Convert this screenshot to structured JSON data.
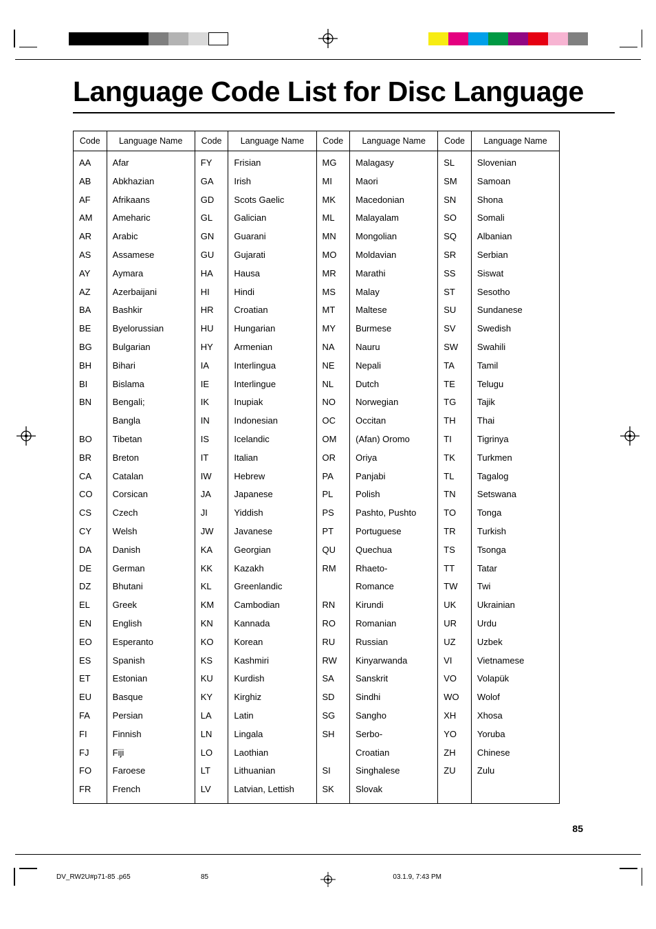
{
  "title": "Language Code List for Disc Language",
  "page_number": "85",
  "footer": {
    "file": "DV_RW2U#p71-85 .p65",
    "page": "85",
    "date": "03.1.9, 7:43 PM"
  },
  "headers": {
    "code": "Code",
    "name": "Language Name"
  },
  "swatches_left": [
    "#000",
    "#000",
    "#000",
    "#000",
    "#7f7f7f",
    "#b3b3b3",
    "#d9d9d9",
    "#fff"
  ],
  "swatches_right": [
    "#f7ec13",
    "#e4007f",
    "#00a0e9",
    "#009944",
    "#920783",
    "#e60012",
    "#f7b4d2",
    "#808080"
  ],
  "columns": [
    {
      "codes": [
        "AA",
        "AB",
        "AF",
        "AM",
        "AR",
        "AS",
        "AY",
        "AZ",
        "BA",
        "BE",
        "BG",
        "BH",
        "BI",
        "BN",
        "",
        "BO",
        "BR",
        "CA",
        "CO",
        "CS",
        "CY",
        "DA",
        "DE",
        "DZ",
        "EL",
        "EN",
        "EO",
        "ES",
        "ET",
        "EU",
        "FA",
        "FI",
        "FJ",
        "FO",
        "FR"
      ],
      "names": [
        "Afar",
        "Abkhazian",
        "Afrikaans",
        "Ameharic",
        "Arabic",
        "Assamese",
        "Aymara",
        "Azerbaijani",
        "Bashkir",
        "Byelorussian",
        "Bulgarian",
        "Bihari",
        "Bislama",
        "Bengali;",
        "Bangla",
        "Tibetan",
        "Breton",
        "Catalan",
        "Corsican",
        "Czech",
        "Welsh",
        "Danish",
        "German",
        "Bhutani",
        "Greek",
        "English",
        "Esperanto",
        "Spanish",
        "Estonian",
        "Basque",
        "Persian",
        "Finnish",
        "Fiji",
        "Faroese",
        "French"
      ]
    },
    {
      "codes": [
        "FY",
        "GA",
        "GD",
        "GL",
        "GN",
        "GU",
        "HA",
        "HI",
        "HR",
        "HU",
        "HY",
        "IA",
        "IE",
        "IK",
        "IN",
        "IS",
        "IT",
        "IW",
        "JA",
        "JI",
        "JW",
        "KA",
        "KK",
        "KL",
        "KM",
        "KN",
        "KO",
        "KS",
        "KU",
        "KY",
        "LA",
        "LN",
        "LO",
        "LT",
        "LV"
      ],
      "names": [
        "Frisian",
        "Irish",
        "Scots Gaelic",
        "Galician",
        "Guarani",
        "Gujarati",
        "Hausa",
        "Hindi",
        "Croatian",
        "Hungarian",
        "Armenian",
        "Interlingua",
        "Interlingue",
        "Inupiak",
        "Indonesian",
        "Icelandic",
        "Italian",
        "Hebrew",
        "Japanese",
        "Yiddish",
        "Javanese",
        "Georgian",
        "Kazakh",
        "Greenlandic",
        "Cambodian",
        "Kannada",
        "Korean",
        "Kashmiri",
        "Kurdish",
        "Kirghiz",
        "Latin",
        "Lingala",
        "Laothian",
        "Lithuanian",
        "Latvian, Lettish"
      ]
    },
    {
      "codes": [
        "MG",
        "MI",
        "MK",
        "ML",
        "MN",
        "MO",
        "MR",
        "MS",
        "MT",
        "MY",
        "NA",
        "NE",
        "NL",
        "NO",
        "OC",
        "OM",
        "OR",
        "PA",
        "PL",
        "PS",
        "PT",
        "QU",
        "RM",
        "",
        "RN",
        "RO",
        "RU",
        "RW",
        "SA",
        "SD",
        "SG",
        "SH",
        "",
        "SI",
        "SK"
      ],
      "names": [
        "Malagasy",
        "Maori",
        "Macedonian",
        "Malayalam",
        "Mongolian",
        "Moldavian",
        "Marathi",
        "Malay",
        "Maltese",
        "Burmese",
        "Nauru",
        "Nepali",
        "Dutch",
        "Norwegian",
        "Occitan",
        "(Afan) Oromo",
        "Oriya",
        "Panjabi",
        "Polish",
        "Pashto, Pushto",
        "Portuguese",
        "Quechua",
        "Rhaeto-",
        "Romance",
        "Kirundi",
        "Romanian",
        "Russian",
        "Kinyarwanda",
        "Sanskrit",
        "Sindhi",
        "Sangho",
        "Serbo-",
        "Croatian",
        "Singhalese",
        "Slovak"
      ]
    },
    {
      "codes": [
        "SL",
        "SM",
        "SN",
        "SO",
        "SQ",
        "SR",
        "SS",
        "ST",
        "SU",
        "SV",
        "SW",
        "TA",
        "TE",
        "TG",
        "TH",
        "TI",
        "TK",
        "TL",
        "TN",
        "TO",
        "TR",
        "TS",
        "TT",
        "TW",
        "UK",
        "UR",
        "UZ",
        "VI",
        "VO",
        "WO",
        "XH",
        "YO",
        "ZH",
        "ZU",
        ""
      ],
      "names": [
        "Slovenian",
        "Samoan",
        "Shona",
        "Somali",
        "Albanian",
        "Serbian",
        "Siswat",
        "Sesotho",
        "Sundanese",
        "Swedish",
        "Swahili",
        "Tamil",
        "Telugu",
        "Tajik",
        "Thai",
        "Tigrinya",
        "Turkmen",
        "Tagalog",
        "Setswana",
        "Tonga",
        "Turkish",
        "Tsonga",
        "Tatar",
        "Twi",
        "Ukrainian",
        "Urdu",
        "Uzbek",
        "Vietnamese",
        "Volapük",
        "Wolof",
        "Xhosa",
        "Yoruba",
        "Chinese",
        "Zulu",
        ""
      ]
    }
  ]
}
